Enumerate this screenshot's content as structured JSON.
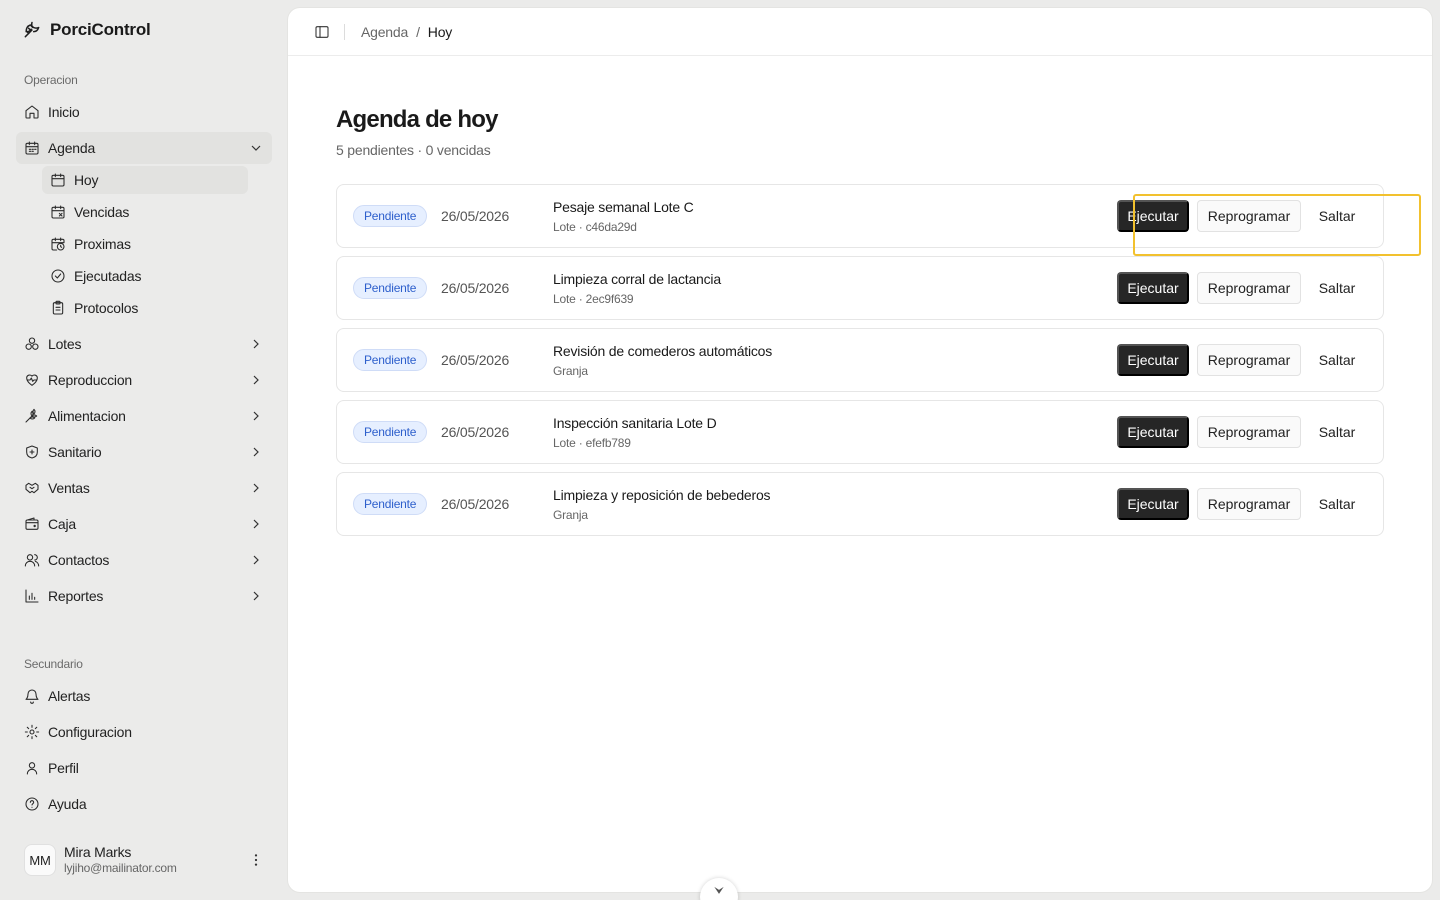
{
  "app": {
    "name": "PorciControl"
  },
  "sidebar": {
    "groups": {
      "operacion": "Operacion",
      "secundario": "Secundario"
    },
    "items": {
      "inicio": "Inicio",
      "agenda": "Agenda",
      "lotes": "Lotes",
      "reproduccion": "Reproduccion",
      "alimentacion": "Alimentacion",
      "sanitario": "Sanitario",
      "ventas": "Ventas",
      "caja": "Caja",
      "contactos": "Contactos",
      "reportes": "Reportes",
      "alertas": "Alertas",
      "configuracion": "Configuracion",
      "perfil": "Perfil",
      "ayuda": "Ayuda"
    },
    "agenda_sub": {
      "hoy": "Hoy",
      "vencidas": "Vencidas",
      "proximas": "Proximas",
      "ejecutadas": "Ejecutadas",
      "protocolos": "Protocolos"
    },
    "user": {
      "initials": "MM",
      "name": "Mira Marks",
      "email": "lyjiho@mailinator.com"
    }
  },
  "breadcrumb": {
    "parent": "Agenda",
    "separator": "/",
    "current": "Hoy"
  },
  "page": {
    "title": "Agenda de hoy",
    "subtitle": "5 pendientes · 0 vencidas"
  },
  "actions": {
    "execute": "Ejecutar",
    "reschedule": "Reprogramar",
    "skip": "Saltar"
  },
  "tasks": [
    {
      "status": "Pendiente",
      "date": "26/05/2026",
      "title": "Pesaje semanal Lote C",
      "meta": "Lote · c46da29d"
    },
    {
      "status": "Pendiente",
      "date": "26/05/2026",
      "title": "Limpieza corral de lactancia",
      "meta": "Lote · 2ec9f639"
    },
    {
      "status": "Pendiente",
      "date": "26/05/2026",
      "title": "Revisión de comederos automáticos",
      "meta": "Granja"
    },
    {
      "status": "Pendiente",
      "date": "26/05/2026",
      "title": "Inspección sanitaria Lote D",
      "meta": "Lote · efefb789"
    },
    {
      "status": "Pendiente",
      "date": "26/05/2026",
      "title": "Limpieza y reposición de bebederos",
      "meta": "Granja"
    }
  ],
  "colors": {
    "accent_dark": "#262626",
    "badge_bg": "#e6efff",
    "badge_text": "#2d5fcc",
    "highlight": "#f2c12e"
  }
}
